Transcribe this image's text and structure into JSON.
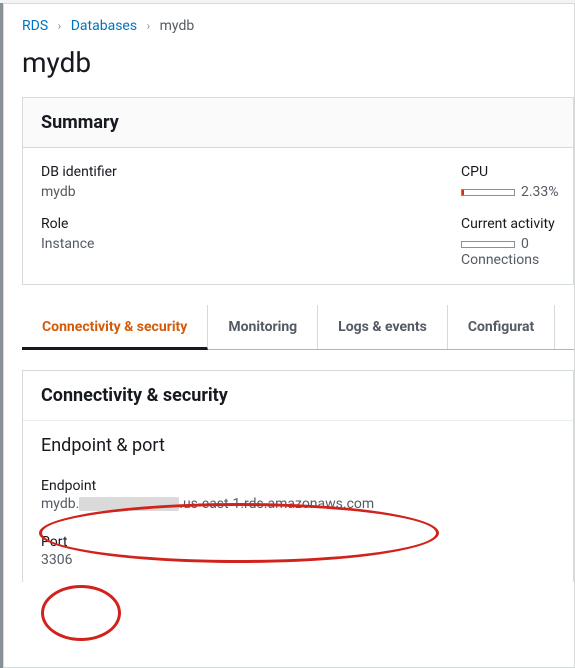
{
  "breadcrumbs": {
    "root": "RDS",
    "db_list": "Databases",
    "current": "mydb"
  },
  "page_title": "mydb",
  "summary": {
    "heading": "Summary",
    "db_identifier_label": "DB identifier",
    "db_identifier_value": "mydb",
    "role_label": "Role",
    "role_value": "Instance",
    "cpu_label": "CPU",
    "cpu_value": "2.33%",
    "activity_label": "Current activity",
    "activity_value": "0 Connections"
  },
  "tabs": {
    "conn": "Connectivity & security",
    "mon": "Monitoring",
    "logs": "Logs & events",
    "conf": "Configurat"
  },
  "conn_panel": {
    "heading": "Connectivity & security",
    "section": "Endpoint & port",
    "endpoint_label": "Endpoint",
    "endpoint_prefix": "mydb.",
    "endpoint_suffix": ".us-east-1.rds.amazonaws.com",
    "port_label": "Port",
    "port_value": "3306"
  }
}
